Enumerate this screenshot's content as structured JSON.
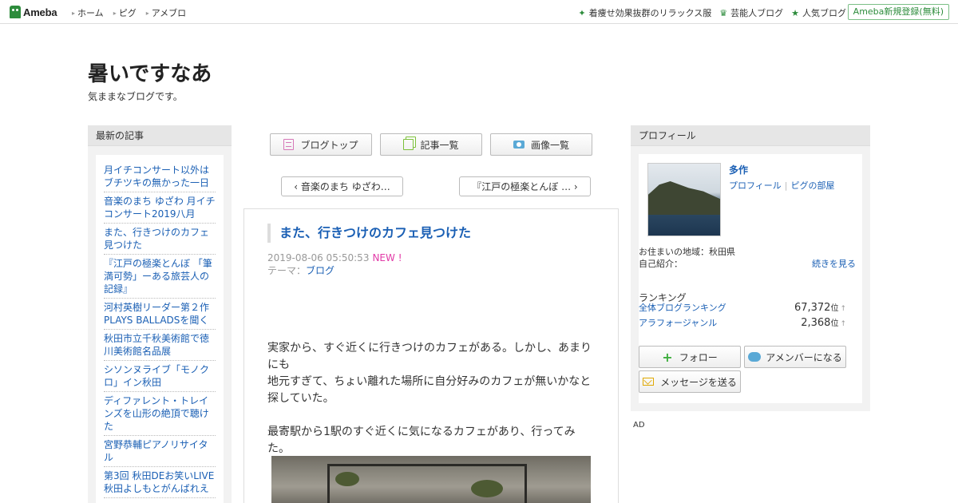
{
  "topbar": {
    "logo": "Ameba",
    "nav": [
      "ホーム",
      "ピグ",
      "アメブロ"
    ],
    "right_links": [
      {
        "label": "着痩せ効果抜群のリラックス服",
        "icon": "sparkle-icon"
      },
      {
        "label": "芸能人ブログ",
        "icon": "crown-icon"
      },
      {
        "label": "人気ブログ",
        "icon": "star-icon"
      }
    ],
    "signup": "Ameba新規登録(無料)"
  },
  "blog": {
    "title": "暑いですなあ",
    "description": "気ままなブログです。"
  },
  "left": {
    "heading": "最新の記事",
    "articles": [
      "月イチコンサート以外はブチツキの無かった一日",
      "音楽のまち ゆざわ 月イチコンサート2019八月",
      "また、行きつけのカフェ見つけた",
      "『江戸の極楽とんぼ 「筆満可勢」ーある旅芸人の記録』",
      "河村英樹リーダー第２作PLAYS BALLADSを聞く",
      "秋田市立千秋美術館で徳川美術館名品展",
      "シソンヌライブ「モノクロ」イン秋田",
      "ディファレント・トレインズを山形の絶頂で聴けた",
      "宮野恭輔ピアノリサイタル",
      "第3回 秋田DEお笑いLIVE 秋田よしもとがんばれえ"
    ]
  },
  "center": {
    "buttons": [
      {
        "label": "ブログトップ",
        "icon": "document-icon"
      },
      {
        "label": "記事一覧",
        "icon": "list-icon"
      },
      {
        "label": "画像一覧",
        "icon": "camera-icon"
      }
    ],
    "prev": "‹ 音楽のまち ゆざわ…",
    "next": "『江戸の極楽とんぼ … ›",
    "entry": {
      "title": "また、行きつけのカフェ見つけた",
      "date": "2019-08-06 05:50:53",
      "new_badge": "NEW !",
      "theme_label": "テーマ：",
      "theme": "ブログ",
      "paragraph1": "実家から、すぐ近くに行きつけのカフェがある。しかし、あまりにも",
      "paragraph2": "地元すぎて、ちょい離れた場所に自分好みのカフェが無いかなと探していた。",
      "paragraph3": "最寄駅から1駅のすぐ近くに気になるカフェがあり、行ってみた。"
    }
  },
  "right": {
    "heading": "プロフィール",
    "name": "多作",
    "links": [
      "プロフィール",
      "ピグの部屋"
    ],
    "residence": "お住まいの地域：秋田県",
    "intro_label": "自己紹介：",
    "more": "続きを見る",
    "ranking_title": "ランキング",
    "rankings": [
      {
        "label": "全体ブログランキング",
        "value": "67,372",
        "unit": "位",
        "arrow": "↑"
      },
      {
        "label": "アラフォージャンル",
        "value": "2,368",
        "unit": "位",
        "arrow": "↑"
      }
    ],
    "buttons": {
      "follow": "フォロー",
      "member": "アメンバーになる",
      "message": "メッセージを送る"
    }
  },
  "ad_label": "AD"
}
